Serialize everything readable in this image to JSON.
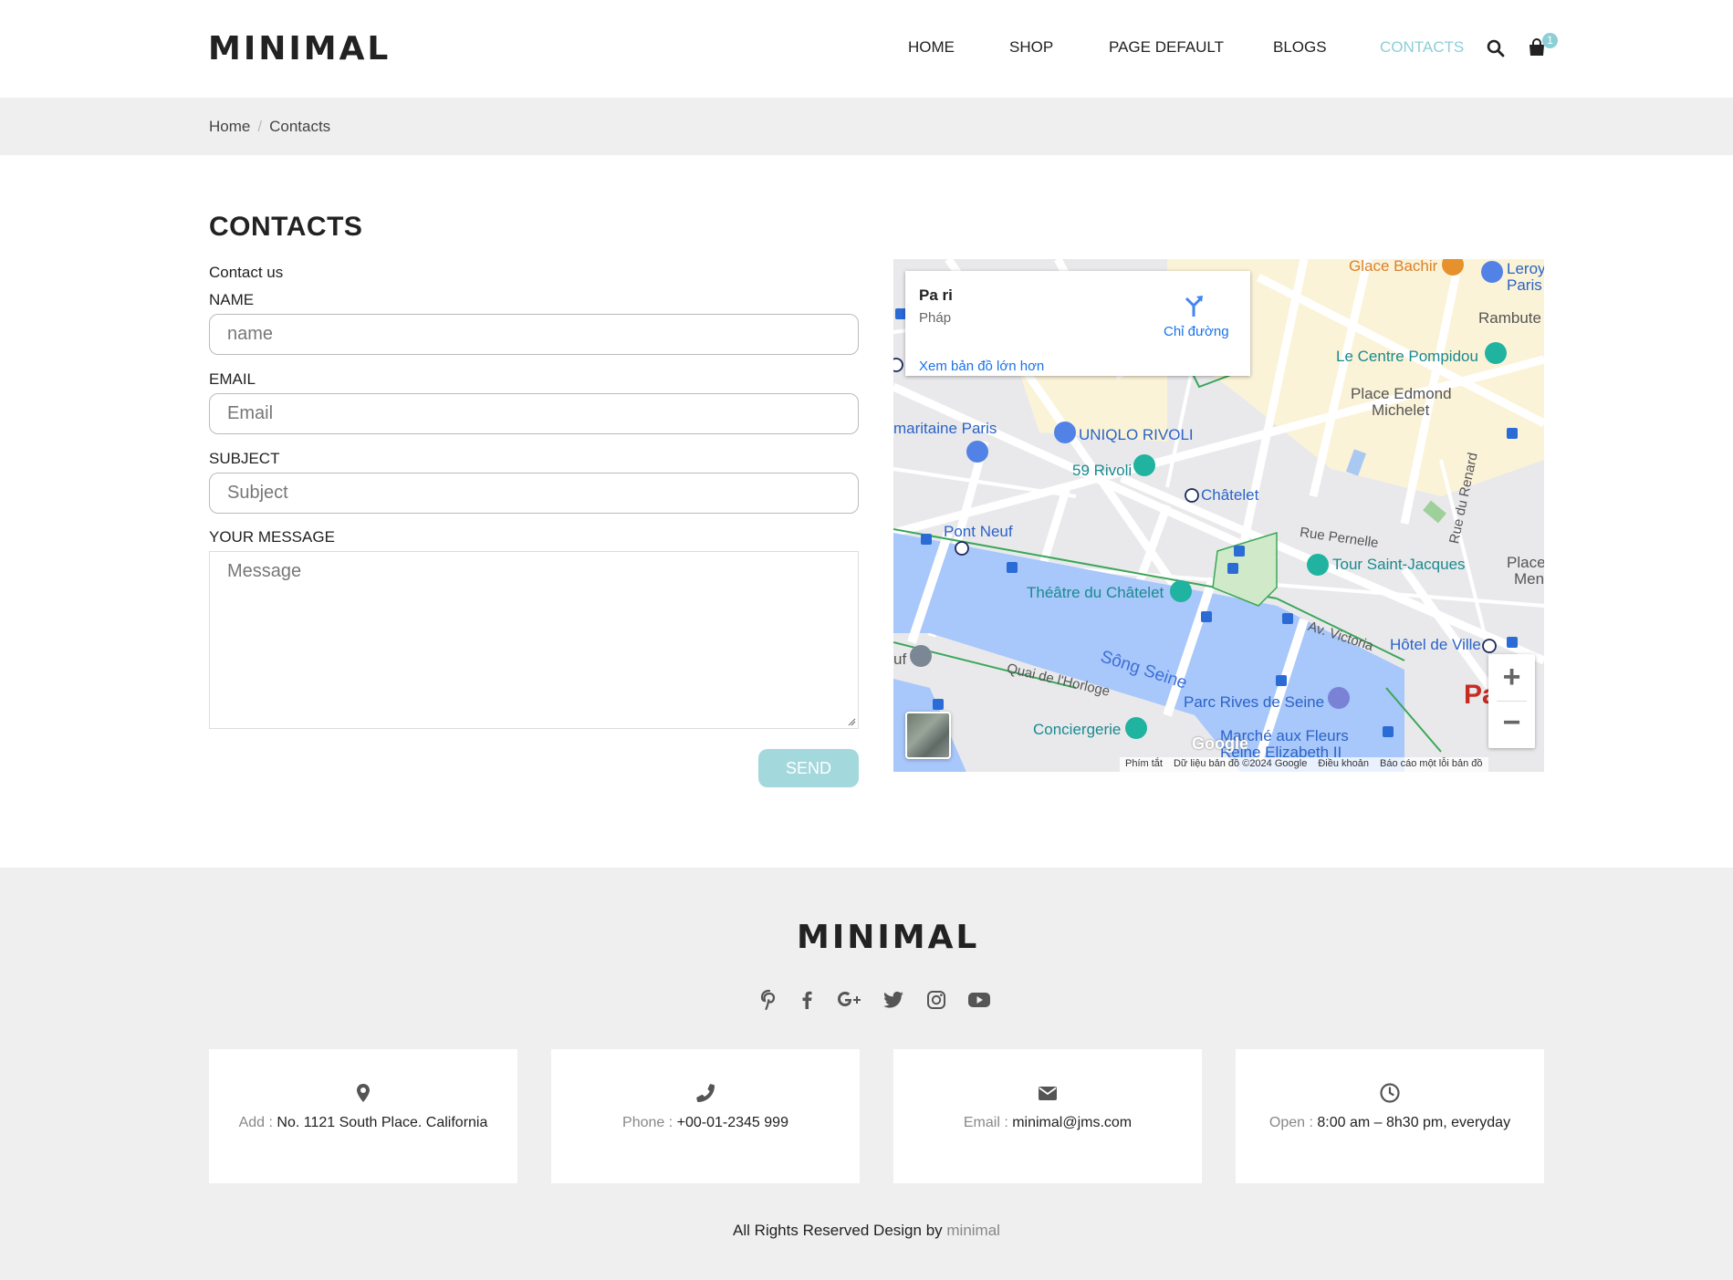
{
  "brand": {
    "logo_text": "MINIMAL"
  },
  "nav": {
    "items": [
      {
        "label": "HOME"
      },
      {
        "label": "SHOP"
      },
      {
        "label": "PAGE DEFAULT"
      },
      {
        "label": "BLOGS"
      },
      {
        "label": "CONTACTS",
        "active": true
      }
    ],
    "cart_count": "1",
    "accent_color": "#8ccfd6"
  },
  "breadcrumb": {
    "items": [
      "Home",
      "Contacts"
    ],
    "separator": "/"
  },
  "contact": {
    "title": "CONTACTS",
    "subtitle": "Contact us",
    "fields": {
      "name": {
        "label": "NAME",
        "placeholder": "name",
        "value": ""
      },
      "email": {
        "label": "EMAIL",
        "placeholder": "Email",
        "value": ""
      },
      "subject": {
        "label": "SUBJECT",
        "placeholder": "Subject",
        "value": ""
      },
      "message": {
        "label": "YOUR MESSAGE",
        "placeholder": "Message",
        "value": ""
      }
    },
    "send_label": "SEND"
  },
  "map": {
    "card": {
      "place": "Pa ri",
      "country": "Pháp",
      "directions": "Chỉ đường",
      "larger_map": "Xem bản đồ lớn hơn"
    },
    "labels": {
      "glace_bachir": "Glace Bachir",
      "leroy": "Leroy",
      "paris_small": "Paris",
      "rambute": "Rambute",
      "pompidou": "Le Centre Pompidou",
      "place_edmond": "Place Edmond",
      "michelet": "Michelet",
      "samaritaine": "maritaine Paris",
      "uniqlo": "UNIQLO RIVOLI",
      "rivoli59": "59 Rivoli",
      "chatelet": "Châtelet",
      "pont_neuf": "Pont Neuf",
      "rue_pernelle": "Rue Pernelle",
      "rue_renard": "Rue du Renard",
      "tour_st_jacques": "Tour Saint-Jacques",
      "place_a": "Place /",
      "place_men": "Men",
      "theatre": "Théâtre du Châtelet",
      "av_victoria": "Av. Victoria",
      "hotel_ville": "Hôtel de Ville",
      "seine": "Sông Seine",
      "quai": "Quai de l'Horloge",
      "parc_rives": "Parc Rives de Seine",
      "conciergerie": "Conciergerie",
      "marche_fleurs": "Marché aux Fleurs",
      "reine": "Reine Elizabeth II",
      "paris_big": "Pa",
      "uf": "uf"
    },
    "footer": {
      "shortcuts": "Phím tắt",
      "data": "Dữ liệu bản đồ ©2024 Google",
      "terms": "Điều khoản",
      "report": "Báo cáo một lỗi bản đồ"
    },
    "zoom_in": "+",
    "zoom_out": "−",
    "google": "Google"
  },
  "footer": {
    "socials": [
      "pinterest-icon",
      "facebook-icon",
      "google-plus-icon",
      "twitter-icon",
      "instagram-icon",
      "youtube-icon"
    ],
    "info": [
      {
        "icon": "map-pin-icon",
        "key": "Add :",
        "value": "No. 1121 South Place. California"
      },
      {
        "icon": "phone-icon",
        "key": "Phone :",
        "value": "+00-01-2345 999"
      },
      {
        "icon": "envelope-icon",
        "key": "Email :",
        "value": "minimal@jms.com"
      },
      {
        "icon": "clock-icon",
        "key": "Open :",
        "value": "8:00 am – 8h30 pm, everyday"
      }
    ],
    "copyright_prefix": "All Rights Reserved Design by",
    "copyright_brand": "minimal"
  }
}
